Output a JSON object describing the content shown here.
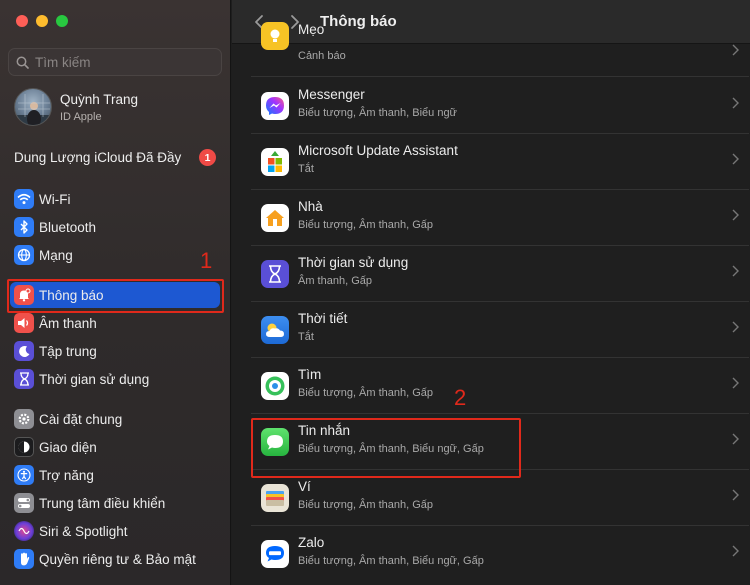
{
  "search": {
    "placeholder": "Tìm kiếm"
  },
  "profile": {
    "name": "Quỳnh Trang",
    "subtitle": "ID Apple"
  },
  "icloud": {
    "label": "Dung Lượng iCloud Đã Đầy",
    "badge": "1"
  },
  "sidebar": {
    "items": [
      {
        "label": "Wi-Fi",
        "icon": "wifi-icon",
        "color": "#2f7cf6"
      },
      {
        "label": "Bluetooth",
        "icon": "bluetooth-icon",
        "color": "#2f7cf6"
      },
      {
        "label": "Mạng",
        "icon": "globe-icon",
        "color": "#2f7cf6"
      },
      {
        "label": "Thông báo",
        "icon": "bell-icon",
        "color": "#f0514b",
        "selected": true
      },
      {
        "label": "Âm thanh",
        "icon": "speaker-icon",
        "color": "#f0514b"
      },
      {
        "label": "Tập trung",
        "icon": "moon-icon",
        "color": "#5a4fd6"
      },
      {
        "label": "Thời gian sử dụng",
        "icon": "hourglass-icon",
        "color": "#5a4fd6"
      },
      {
        "label": "Cài đặt chung",
        "icon": "gear-icon",
        "color": "#8e8e93"
      },
      {
        "label": "Giao diện",
        "icon": "appearance-icon",
        "color": "#1c1c1e"
      },
      {
        "label": "Trợ năng",
        "icon": "accessibility-icon",
        "color": "#2f7cf6"
      },
      {
        "label": "Trung tâm điều khiển",
        "icon": "control-center-icon",
        "color": "#8e8e93"
      },
      {
        "label": "Siri & Spotlight",
        "icon": "siri-icon",
        "color": "#6b3fd8"
      },
      {
        "label": "Quyền riêng tư & Bảo mật",
        "icon": "hand-icon",
        "color": "#2f7cf6"
      }
    ]
  },
  "annotations": {
    "one": "1",
    "two": "2"
  },
  "main": {
    "title": "Thông báo",
    "apps": [
      {
        "name": "Mẹo",
        "status": "Cảnh báo",
        "icon": "tips-icon",
        "color": "#f7c325"
      },
      {
        "name": "Messenger",
        "status": "Biểu tượng, Âm thanh, Biểu ngữ",
        "icon": "messenger-icon",
        "color": "#ffffff"
      },
      {
        "name": "Microsoft Update Assistant",
        "status": "Tắt",
        "icon": "microsoft-update-icon",
        "color": "#ffffff"
      },
      {
        "name": "Nhà",
        "status": "Biểu tượng, Âm thanh, Gấp",
        "icon": "home-icon",
        "color": "#ffffff"
      },
      {
        "name": "Thời gian sử dụng",
        "status": "Âm thanh, Gấp",
        "icon": "screen-time-icon",
        "color": "#5a4fd6"
      },
      {
        "name": "Thời tiết",
        "status": "Tắt",
        "icon": "weather-icon",
        "color": "#3d8ef0"
      },
      {
        "name": "Tìm",
        "status": "Biểu tượng, Âm thanh, Gấp",
        "icon": "find-my-icon",
        "color": "#ffffff"
      },
      {
        "name": "Tin nhắn",
        "status": "Biểu tượng, Âm thanh, Biểu ngữ, Gấp",
        "icon": "messages-icon",
        "color": "#34c759"
      },
      {
        "name": "Ví",
        "status": "Biểu tượng, Âm thanh, Gấp",
        "icon": "wallet-icon",
        "color": "#e9e4d6"
      },
      {
        "name": "Zalo",
        "status": "Biểu tượng, Âm thanh, Biểu ngữ, Gấp",
        "icon": "zalo-icon",
        "color": "#ffffff"
      }
    ]
  }
}
